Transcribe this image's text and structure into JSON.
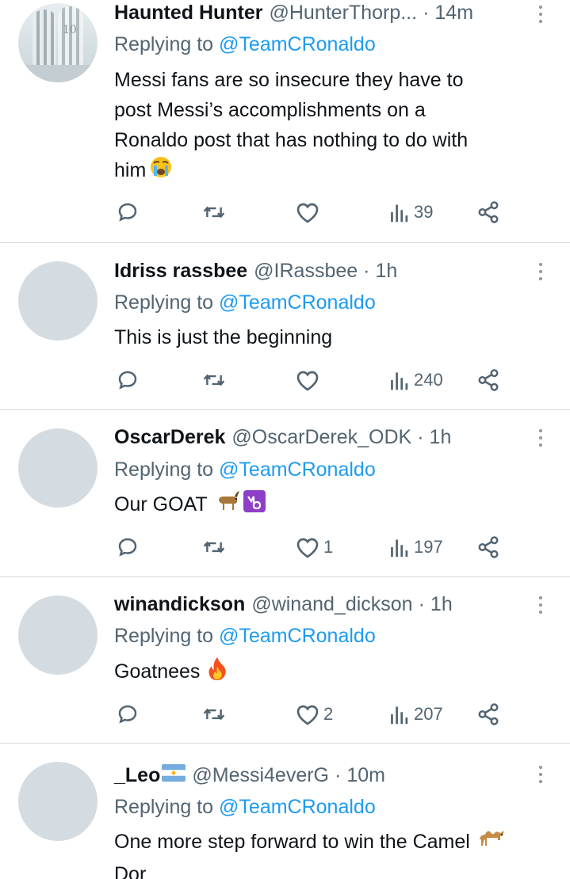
{
  "replying_to_label": "Replying to",
  "tweets": [
    {
      "display_name": "Haunted Hunter",
      "handle": "@HunterThorp...",
      "separator": "·",
      "time": "14m",
      "replying_to": "@TeamCRonaldo",
      "text_lines": [
        "Messi fans are so insecure they have to",
        "post Messi’s accomplishments on a",
        "Ronaldo post that has nothing to do with",
        "him"
      ],
      "emoji": "loudly-crying-face",
      "avatar": "photo",
      "avatar_jersey_number": "10",
      "likes": "",
      "views": "39"
    },
    {
      "display_name": "Idriss rassbee",
      "handle": "@IRassbee",
      "separator": "·",
      "time": "1h",
      "replying_to": "@TeamCRonaldo",
      "text_lines": [
        "This is just the beginning"
      ],
      "avatar": "default",
      "likes": "",
      "views": "240"
    },
    {
      "display_name": "OscarDerek",
      "handle": "@OscarDerek_ODK",
      "separator": "·",
      "time": "1h",
      "replying_to": "@TeamCRonaldo",
      "text_lines": [
        "Our GOAT"
      ],
      "emoji": "goat, capricorn",
      "avatar": "default",
      "likes": "1",
      "views": "197"
    },
    {
      "display_name": "winandickson",
      "handle": "@winand_dickson",
      "separator": "·",
      "time": "1h",
      "replying_to": "@TeamCRonaldo",
      "text_lines": [
        "Goatnees"
      ],
      "emoji": "fire",
      "avatar": "default",
      "likes": "2",
      "views": "207"
    },
    {
      "display_name": "_Leo",
      "name_emoji": "argentina-flag",
      "handle": "@Messi4everG",
      "separator": "·",
      "time": "10m",
      "replying_to": "@TeamCRonaldo",
      "text_lines": [
        "One more step forward to win the Camel",
        "Dor"
      ],
      "emoji": "camel",
      "avatar": "default"
    }
  ],
  "colors": {
    "text": "#0f1419",
    "secondary": "#536471",
    "link": "#1d9bf0",
    "avatar_placeholder": "#d5dce1",
    "divider": "#d3dadf"
  }
}
